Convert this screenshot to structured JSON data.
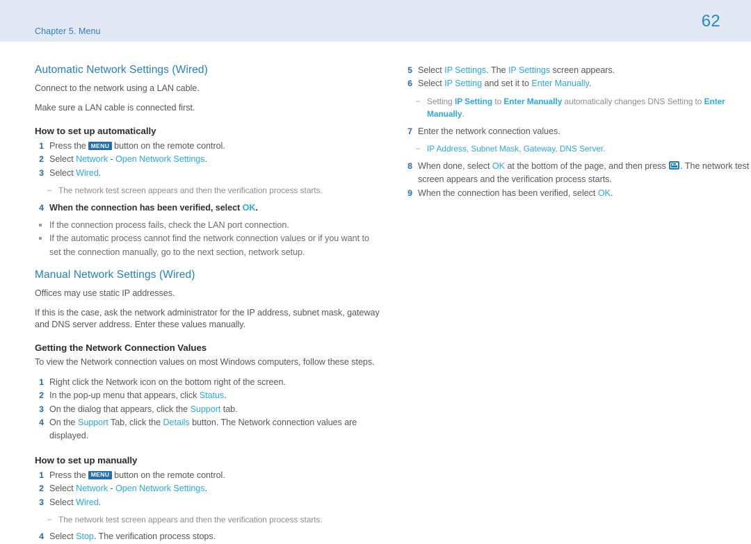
{
  "header": {
    "chapter": "Chapter 5. Menu",
    "page_number": "62",
    "band_color": "#e3e8f5",
    "chapter_color": "#2f7fc1",
    "page_number_color": "#1e8bd0"
  },
  "colors": {
    "heading_blue": "#1e82c8",
    "term_cyan": "#2aabe4",
    "step_number_blue": "#1f6fb2",
    "body_gray": "#58585a",
    "subtle_gray": "#8e8e90",
    "key_badge_bg": "#1f6fb2"
  },
  "left_column": {
    "section1": {
      "heading": "Automatic Network Settings (Wired)",
      "intro1": "Connect to the network using a LAN cable.",
      "intro2": "Make sure a LAN cable is connected first.",
      "subheading": "How to set up automatically",
      "steps": [
        {
          "num": "1",
          "pre": "Press the ",
          "key": "MENU",
          "post": " button on the remote control."
        },
        {
          "num": "2",
          "pre": "Select ",
          "term1": "Network",
          "mid": " - ",
          "term2": "Open Network Settings",
          "post": "."
        },
        {
          "num": "3",
          "pre": "Select ",
          "term1": "Wired",
          "post": "."
        }
      ],
      "dash_note": "The network test screen appears and then the verification process starts.",
      "step4": {
        "num": "4",
        "pre": "When the connection has been verified, select ",
        "term1": "OK",
        "post": "."
      },
      "bullets": [
        "If the connection process fails, check the LAN port connection.",
        "If the automatic process cannot find the network connection values or if you want to set the connection manually, go to the next section, network setup."
      ]
    },
    "section2": {
      "heading": "Manual Network Settings (Wired)",
      "intro1": "Offices may use static IP addresses.",
      "intro2": "If this is the case, ask the network administrator for the IP address, subnet mask, gateway and DNS server address. Enter these values manually.",
      "subheading1": "Getting the Network Connection Values",
      "intro3": "To view the Network connection values on most Windows computers, follow these steps.",
      "steps": [
        {
          "num": "1",
          "pre": "Right click the Network icon on the bottom right of the screen."
        },
        {
          "num": "2",
          "pre": "In the pop-up menu that appears, click ",
          "term1": "Status",
          "post": "."
        },
        {
          "num": "3",
          "pre": "On the dialog that appears, click the ",
          "term1": "Support",
          "post": " tab."
        },
        {
          "num": "4",
          "pre": "On the ",
          "term1": "Support",
          "mid": " Tab, click the ",
          "term2": "Details",
          "post": " button. The Network connection values are displayed."
        }
      ],
      "subheading2": "How to set up manually",
      "steps2": [
        {
          "num": "1",
          "pre": "Press the ",
          "key": "MENU",
          "post": " button on the remote control."
        },
        {
          "num": "2",
          "pre": "Select ",
          "term1": "Network",
          "mid": " - ",
          "term2": "Open Network Settings",
          "post": "."
        },
        {
          "num": "3",
          "pre": "Select ",
          "term1": "Wired",
          "post": "."
        }
      ],
      "dash_note": "The network test screen appears and then the verification process starts.",
      "step4b": {
        "num": "4",
        "pre": "Select ",
        "term1": "Stop",
        "post": ". The verification process stops."
      }
    }
  },
  "right_column": {
    "step5": {
      "num": "5",
      "pre": "Select ",
      "term1": "IP Settings",
      "mid": ". The ",
      "term2": "IP Settings",
      "post": " screen appears."
    },
    "step6": {
      "num": "6",
      "pre": "Select ",
      "term1": "IP Setting",
      "mid": " and set it to ",
      "term2": "Enter Manually",
      "post": "."
    },
    "dash6": {
      "pre": "Setting ",
      "term1": "IP Setting",
      "mid": " to ",
      "term2": "Enter Manually",
      "mid2": " automatically changes DNS Setting to ",
      "term3": "Enter Manually",
      "post": "."
    },
    "step7": {
      "num": "7",
      "pre": "Enter the network connection values."
    },
    "dash7": {
      "term1": "IP Address",
      "sep1": ", ",
      "term2": "Subnet Mask",
      "sep2": ", ",
      "term3": "Gateway",
      "sep3": ", ",
      "term4": "DNS Server",
      "post": "."
    },
    "step8": {
      "num": "8",
      "pre": "When done, select ",
      "term1": "OK",
      "mid": " at the bottom of the page, and then press ",
      "icon": "enter-key-icon",
      "post": ". The network test screen appears and the verification process starts."
    },
    "step9": {
      "num": "9",
      "pre": "When the connection has been verified, select ",
      "term1": "OK",
      "post": "."
    }
  }
}
